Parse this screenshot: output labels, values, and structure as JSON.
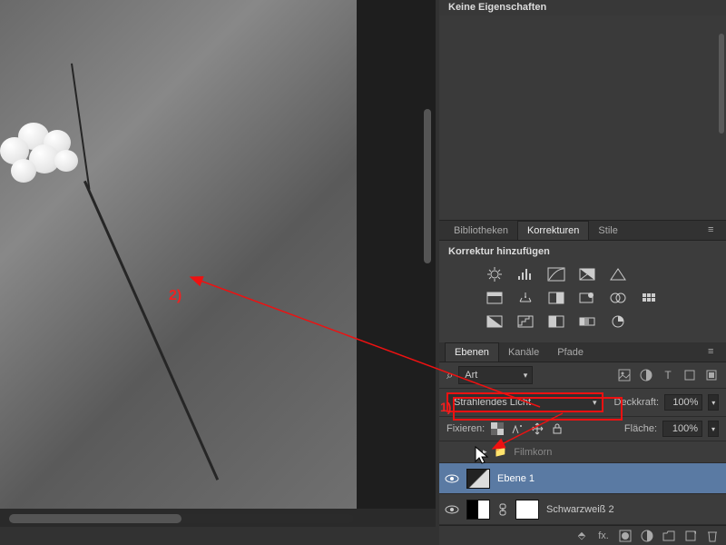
{
  "properties_panel": {
    "title": "Keine Eigenschaften"
  },
  "adjustments_panel": {
    "tabs": [
      "Bibliotheken",
      "Korrekturen",
      "Stile"
    ],
    "active_tab": 1,
    "title": "Korrektur hinzufügen"
  },
  "layers_panel": {
    "tabs": [
      "Ebenen",
      "Kanäle",
      "Pfade"
    ],
    "active_tab": 0,
    "filter": {
      "label": "Art",
      "search_glyph": "⌕"
    },
    "blend": {
      "mode": "Strahlendes Licht",
      "opacity_label": "Deckkraft:",
      "opacity_value": "100%"
    },
    "lock": {
      "label": "Fixieren:",
      "fill_label": "Fläche:",
      "fill_value": "100%"
    },
    "layers": [
      {
        "name": "Filmkorn",
        "type": "group"
      },
      {
        "name": "Ebene 1",
        "type": "gradient",
        "selected": true
      },
      {
        "name": "Schwarzweiß 2",
        "type": "adjustment"
      }
    ],
    "footer_fx": "fx."
  },
  "annotations": {
    "label1": "1)",
    "label2": "2)"
  }
}
